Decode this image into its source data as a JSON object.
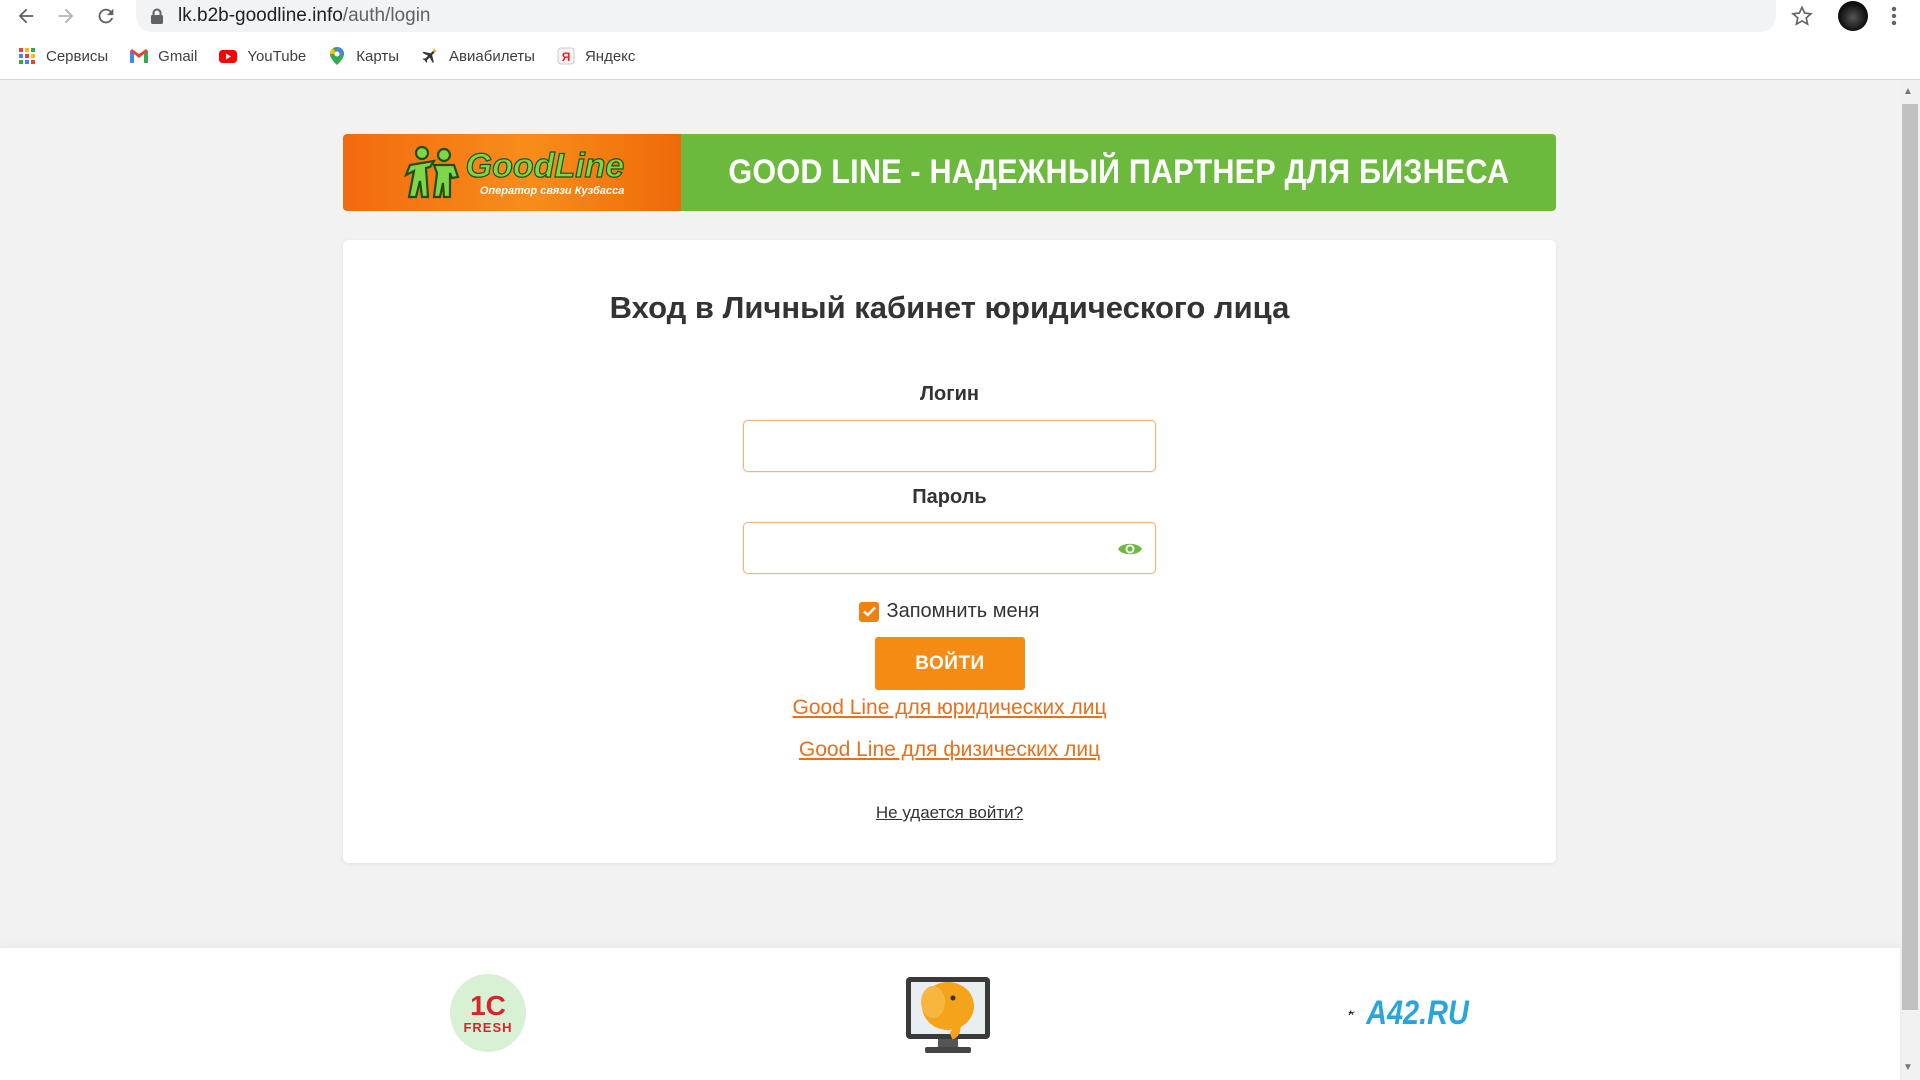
{
  "browser": {
    "url_host": "lk.b2b-goodline.info",
    "url_path": "/auth/login",
    "icons": [
      "back-icon",
      "forward-icon",
      "reload-icon",
      "lock-icon",
      "star-icon",
      "kebab-menu-icon"
    ],
    "bookmarks": [
      {
        "label": "Сервисы",
        "icon": "apps-grid-icon"
      },
      {
        "label": "Gmail",
        "icon": "gmail-icon"
      },
      {
        "label": "YouTube",
        "icon": "youtube-icon"
      },
      {
        "label": "Карты",
        "icon": "maps-pin-icon"
      },
      {
        "label": "Авиабилеты",
        "icon": "airplane-icon"
      },
      {
        "label": "Яндекс",
        "icon": "yandex-icon"
      }
    ]
  },
  "banner": {
    "logo_word": "GoodLine",
    "logo_tagline": "Оператор связи Кузбасса",
    "title": "GOOD LINE - НАДЕЖНЫЙ ПАРТНЕР ДЛЯ БИЗНЕСА",
    "colors": {
      "orange": "#f36a10",
      "green": "#6cba3d"
    }
  },
  "login": {
    "title": "Вход в Личный кабинет юридического лица",
    "login_label": "Логин",
    "login_value": "",
    "password_label": "Пароль",
    "password_value": "",
    "remember_label": "Запомнить меня",
    "remember_checked": true,
    "submit_label": "ВОЙТИ",
    "link_business": "Good Line для юридических лиц",
    "link_personal": "Good Line для физических лиц",
    "link_trouble": "Не удается войти?",
    "accent_color": "#f68b14"
  },
  "footer": {
    "partners": [
      {
        "name": "1C Fresh",
        "text_top": "1С",
        "text_bottom": "FRESH",
        "icon": "1c-fresh-logo"
      },
      {
        "name": "monitor-elephant",
        "icon": "elephant-monitor-logo"
      },
      {
        "name": "A42.RU",
        "text": "A42.RU",
        "icon": "a42-logo"
      }
    ]
  }
}
